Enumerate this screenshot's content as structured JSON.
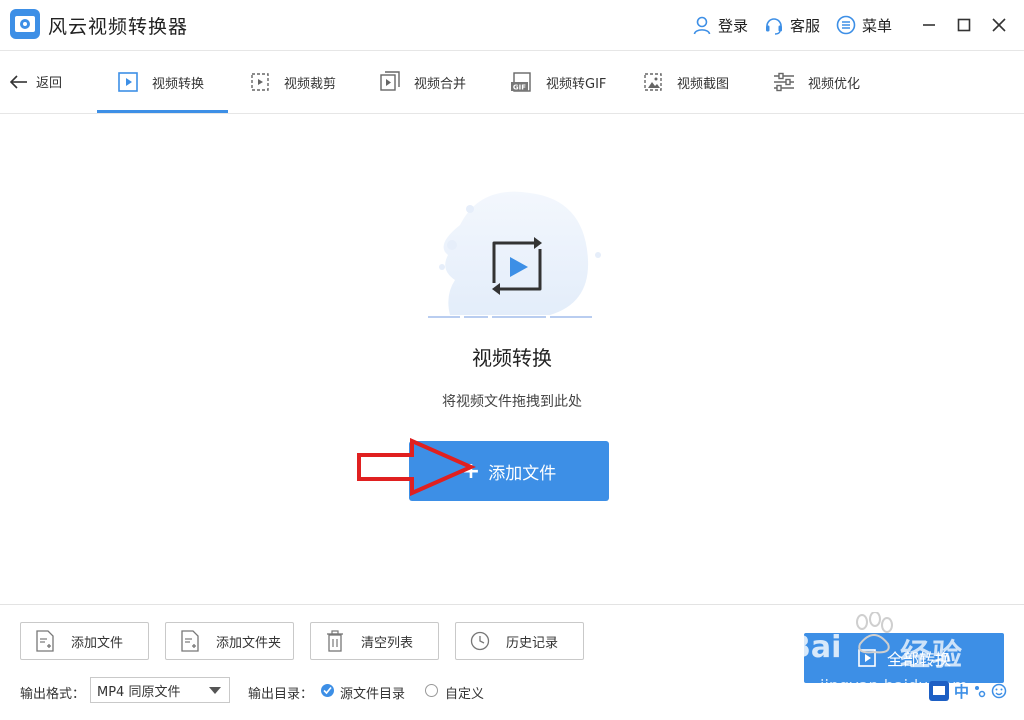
{
  "window": {
    "title": "风云视频转换器",
    "login_label": "登录",
    "service_label": "客服",
    "menu_label": "菜单"
  },
  "nav": {
    "back_label": "返回",
    "tabs": [
      {
        "label": "视频转换",
        "active": true
      },
      {
        "label": "视频裁剪"
      },
      {
        "label": "视频合并"
      },
      {
        "label": "视频转GIF"
      },
      {
        "label": "视频截图"
      },
      {
        "label": "视频优化"
      }
    ]
  },
  "main": {
    "title": "视频转换",
    "subtitle": "将视频文件拖拽到此处",
    "add_file_label": "添加文件",
    "add_file_plus": "+"
  },
  "bottom": {
    "actions": [
      {
        "label": "添加文件"
      },
      {
        "label": "添加文件夹"
      },
      {
        "label": "清空列表"
      },
      {
        "label": "历史记录"
      }
    ],
    "convert_all_label": "全部转换",
    "output_format_label": "输出格式：",
    "output_format_value": "MP4 同原文件",
    "output_dir_label": "输出目录：",
    "output_dir_source": "源文件目录",
    "output_dir_custom": "自定义"
  },
  "watermark": {
    "text_main": "经验",
    "text_sub": "jingyan.baidu.com",
    "baidu": "Bai"
  },
  "ime": {
    "lang": "中"
  },
  "colors": {
    "accent": "#3d8fe6",
    "annotation_arrow": "#e02020"
  }
}
